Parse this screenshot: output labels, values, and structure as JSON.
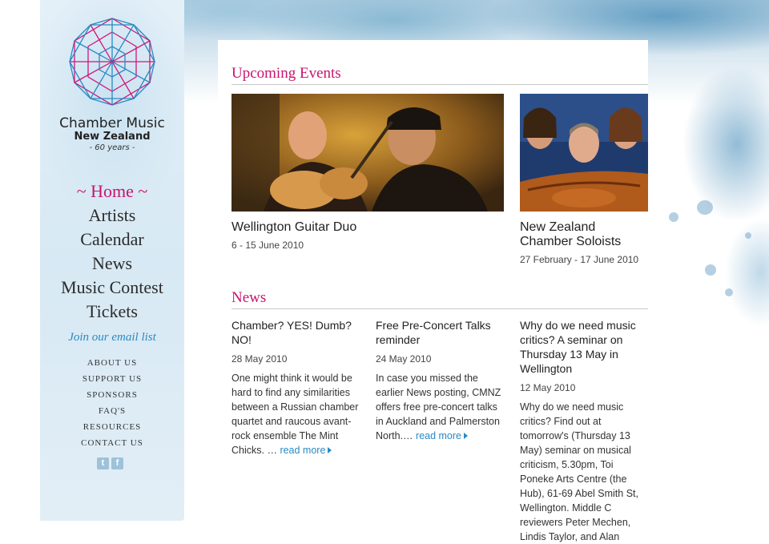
{
  "brand": {
    "line1": "Chamber Music",
    "line2": "New Zealand",
    "line3": "- 60 years -"
  },
  "nav": [
    "~ Home ~",
    "Artists",
    "Calendar",
    "News",
    "Music Contest",
    "Tickets"
  ],
  "email_link": "Join our email list",
  "small_nav": [
    "ABOUT US",
    "SUPPORT US",
    "SPONSORS",
    "FAQ'S",
    "RESOURCES",
    "CONTACT US"
  ],
  "social": {
    "twitter": "twitter-icon",
    "facebook": "facebook-icon"
  },
  "colors": {
    "accent": "#c8146f",
    "link": "#2a8ac4"
  },
  "upcoming": {
    "heading": "Upcoming Events",
    "events": [
      {
        "title": "Wellington Guitar Duo",
        "date": "6 - 15 June 2010"
      },
      {
        "title": "New Zealand Chamber Soloists",
        "date": "27 February - 17 June 2010"
      }
    ]
  },
  "news": {
    "heading": "News",
    "items": [
      {
        "title": "Chamber? YES! Dumb? NO!",
        "date": "28 May 2010",
        "body": "One might think it would be hard to find any similarities between a Russian chamber quartet and raucous avant-rock ensemble The Mint Chicks. …",
        "more": "read more"
      },
      {
        "title": "Free Pre-Concert Talks reminder",
        "date": "24 May 2010",
        "body": "In case you missed the earlier News posting, CMNZ offers free pre-concert talks in Auckland and Palmerston North.…",
        "more": "read more"
      },
      {
        "title": "Why do we need music critics? A seminar on Thursday 13 May in Wellington",
        "date": "12 May 2010",
        "body": "Why do we need music critics? Find out at tomorrow's (Thursday 13 May) seminar on musical criticism, 5.30pm, Toi Poneke Arts Centre (the Hub), 61-69 Abel Smith St, Wellington. Middle C reviewers Peter Mechen, Lindis Taylor, and Alan",
        "more": ""
      }
    ]
  }
}
